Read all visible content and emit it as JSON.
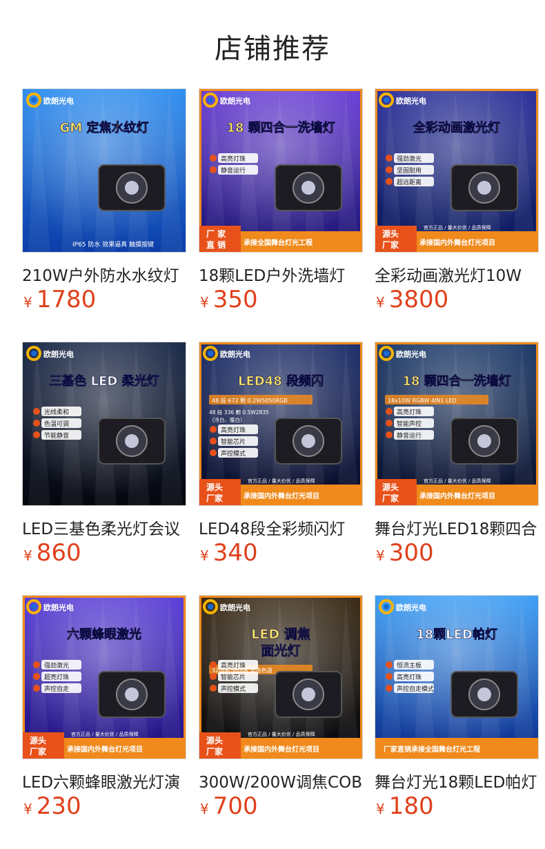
{
  "header": {
    "title": "店铺推荐"
  },
  "brand": {
    "logo_text": "欧朗光电"
  },
  "colors": {
    "price": "#e0401c",
    "frame": "#f08a1c",
    "badge": "#e8521a"
  },
  "products": [
    {
      "name": "210W户外防水水纹灯",
      "currency": "¥",
      "price": "1780",
      "image": {
        "headline": "GM 定焦水纹灯",
        "footer": "IP65 防水  效果逼真  触摸按键",
        "features": [],
        "bottom_left": "",
        "bottom_right": ""
      }
    },
    {
      "name": "18颗LED户外洗墙灯",
      "currency": "¥",
      "price": "350",
      "image": {
        "headline": "18 颗四合一洗墙灯",
        "features": [
          "高亮灯珠",
          "静音运行"
        ],
        "bottom_left": "厂 家\n直 销",
        "bottom_right": "承接全国舞台灯光工程",
        "footer": ""
      }
    },
    {
      "name": "全彩动画激光灯10W",
      "currency": "¥",
      "price": "3800",
      "image": {
        "headline": "全彩动画激光灯",
        "features": [
          "强劲激光",
          "坚固耐用",
          "超远距离"
        ],
        "bottom_left": "源头\n厂家",
        "bottom_top": "官方正品 / 量大价优 / 品质保障",
        "bottom_right": "承接国内外舞台灯光项目",
        "footer": ""
      }
    },
    {
      "name": "LED三基色柔光灯会议",
      "currency": "¥",
      "price": "860",
      "image": {
        "headline": "三基色 LED 柔光灯",
        "features": [
          "光线柔和",
          "色温可调",
          "节能静音"
        ],
        "bottom_left": "",
        "bottom_right": "",
        "footer": ""
      }
    },
    {
      "name": "LED48段全彩频闪灯",
      "currency": "¥",
      "price": "340",
      "image": {
        "headline": "LED48 段频闪",
        "subline": "48 段 672 颗 0.2W5050RGB",
        "note": "48 段 336 颗 0.5W2835\n（冷白、暖白）",
        "features": [
          "高亮灯珠",
          "智能芯片",
          "声控模式"
        ],
        "bottom_left": "源头\n厂家",
        "bottom_top": "官方正品 / 量大价优 / 品质保障",
        "bottom_right": "承接国内外舞台灯光项目",
        "footer": ""
      }
    },
    {
      "name": "舞台灯光LED18颗四合一",
      "currency": "¥",
      "price": "300",
      "image": {
        "headline": "18 颗四合一洗墙灯",
        "subline": "18x10W RGBW 4IN1 LED",
        "features": [
          "高亮灯珠",
          "智能声控",
          "静音运行"
        ],
        "bottom_left": "源头\n厂家",
        "bottom_top": "官方正品 / 量大价优 / 品质保障",
        "bottom_right": "承接国内外舞台灯光项目",
        "footer": ""
      }
    },
    {
      "name": "LED六颗蜂眼激光灯演",
      "currency": "¥",
      "price": "230",
      "image": {
        "headline": "六颗蜂眼激光",
        "features": [
          "强劲激光",
          "超亮灯珠",
          "声控自走"
        ],
        "bottom_left": "源头\n厂家",
        "bottom_top": "官方正品 / 量大价优 / 品质保障",
        "bottom_right": "承接国内外舞台灯光项目",
        "footer": ""
      }
    },
    {
      "name": "300W/200W调焦COB",
      "currency": "¥",
      "price": "700",
      "image": {
        "headline": "LED 调焦\n面光灯",
        "subline": "3200K-5600K 可选色温",
        "features": [
          "高亮灯珠",
          "智能芯片",
          "声控模式"
        ],
        "bottom_left": "源头\n厂家",
        "bottom_top": "官方正品 / 量大价优 / 品质保障",
        "bottom_right": "承接国内外舞台灯光项目",
        "footer": ""
      }
    },
    {
      "name": "舞台灯光18颗LED帕灯",
      "currency": "¥",
      "price": "180",
      "image": {
        "headline": "18颗LED帕灯",
        "features": [
          "恒流主板",
          "高亮灯珠",
          "声控自走模式"
        ],
        "bottom_left": "",
        "bottom_right": "厂家直销承接全国舞台灯光工程",
        "footer": ""
      }
    }
  ]
}
